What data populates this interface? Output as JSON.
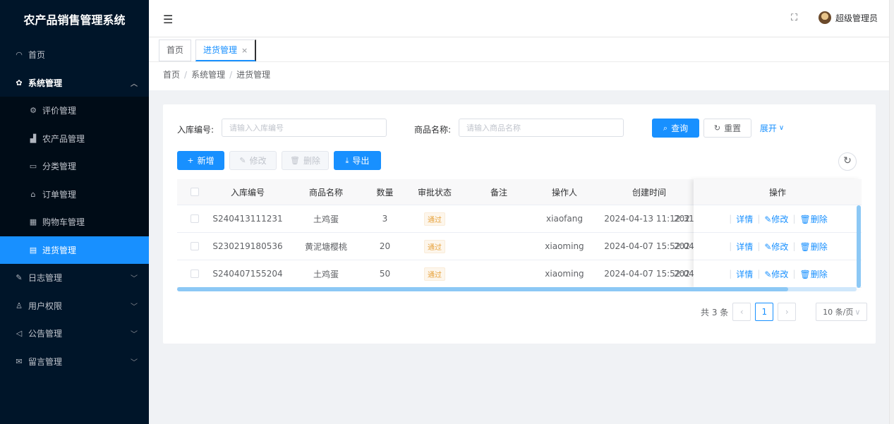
{
  "app_title": "农产品销售管理系统",
  "sidebar": {
    "items": [
      {
        "label": "首页",
        "icon": "dashboard-icon"
      },
      {
        "label": "系统管理",
        "icon": "gear-icon",
        "open": true,
        "children": [
          {
            "label": "评价管理",
            "icon": "settings-icon"
          },
          {
            "label": "农产品管理",
            "icon": "chart-icon"
          },
          {
            "label": "分类管理",
            "icon": "category-icon"
          },
          {
            "label": "订单管理",
            "icon": "lock-icon"
          },
          {
            "label": "购物车管理",
            "icon": "grid-icon"
          },
          {
            "label": "进货管理",
            "icon": "document-icon",
            "active": true
          }
        ]
      },
      {
        "label": "日志管理",
        "icon": "edit-icon"
      },
      {
        "label": "用户权限",
        "icon": "user-icon"
      },
      {
        "label": "公告管理",
        "icon": "megaphone-icon"
      },
      {
        "label": "留言管理",
        "icon": "mail-icon"
      }
    ]
  },
  "header": {
    "user_name": "超级管理员",
    "collapse_icon": "menu-fold-icon",
    "fullscreen_icon": "fullscreen-icon"
  },
  "tabs": [
    {
      "label": "首页",
      "closable": false,
      "active": false
    },
    {
      "label": "进货管理",
      "closable": true,
      "active": true,
      "close_glyph": "×"
    }
  ],
  "breadcrumb": [
    "首页",
    "系统管理",
    "进货管理"
  ],
  "breadcrumb_sep": "/",
  "search": {
    "code_label": "入库编号:",
    "code_placeholder": "请输入入库编号",
    "name_label": "商品名称:",
    "name_placeholder": "请输入商品名称",
    "query_label": "查询",
    "reset_label": "重置",
    "expand_label": "展开"
  },
  "toolbar": {
    "add_label": "新增",
    "edit_label": "修改",
    "delete_label": "删除",
    "export_label": "导出"
  },
  "table": {
    "columns": [
      "入库编号",
      "商品名称",
      "数量",
      "审批状态",
      "备注",
      "操作人",
      "创建时间",
      "操作"
    ],
    "rows": [
      {
        "code": "S240413111231",
        "name": "土鸡蛋",
        "qty": "3",
        "status": "通过",
        "remark": "",
        "operator": "xiaofang",
        "created": "2024-04-13 11:12:31",
        "updated_partial": "202"
      },
      {
        "code": "S230219180536",
        "name": "黄泥塘樱桃",
        "qty": "20",
        "status": "通过",
        "remark": "",
        "operator": "xiaoming",
        "created": "2024-04-07 15:52:04",
        "updated_partial": "202"
      },
      {
        "code": "S240407155204",
        "name": "土鸡蛋",
        "qty": "50",
        "status": "通过",
        "remark": "",
        "operator": "xiaoming",
        "created": "2024-04-07 15:52:04",
        "updated_partial": "202"
      }
    ],
    "row_actions": {
      "detail": "详情",
      "edit": "修改",
      "delete": "删除"
    }
  },
  "pagination": {
    "total_text": "共 3 条",
    "current_page": "1",
    "page_size": "10 条/页"
  },
  "colors": {
    "sidebar_bg": "#001529",
    "accent": "#1890ff",
    "status_badge": "#e6a23c"
  }
}
